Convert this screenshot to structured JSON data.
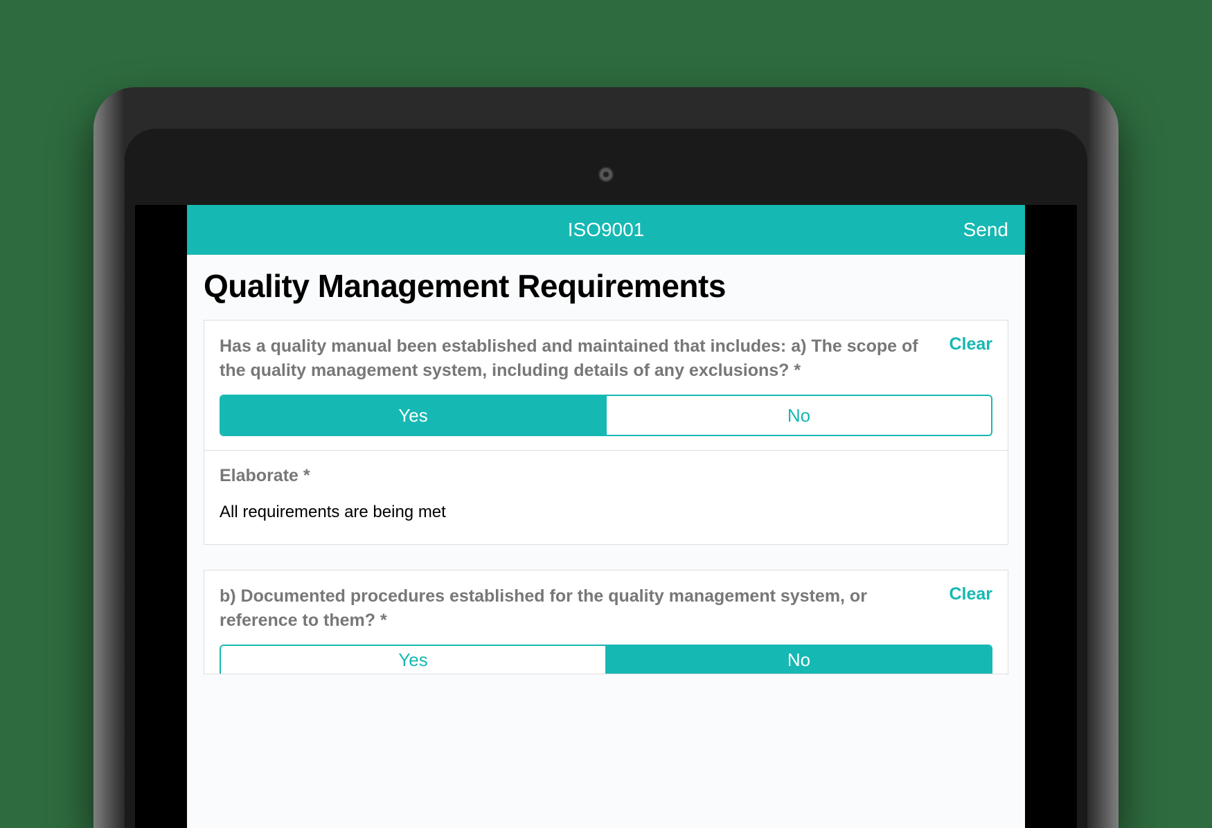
{
  "colors": {
    "accent": "#16b8b3",
    "background": "#fafbfc",
    "pageBackground": "#2e6b3e"
  },
  "header": {
    "title": "ISO9001",
    "send_label": "Send"
  },
  "page": {
    "title": "Quality Management Requirements"
  },
  "questions": [
    {
      "text": "Has a quality manual been established and maintained that includes: a) The scope of the quality management system, including details of any exclusions? *",
      "clear_label": "Clear",
      "options": {
        "yes": "Yes",
        "no": "No"
      },
      "selected": "yes",
      "elaborate": {
        "label": "Elaborate *",
        "value": "All requirements are being met"
      }
    },
    {
      "text": "b) Documented procedures established for the quality management system, or reference to them? *",
      "clear_label": "Clear",
      "options": {
        "yes": "Yes",
        "no": "No"
      },
      "selected": "no"
    }
  ]
}
